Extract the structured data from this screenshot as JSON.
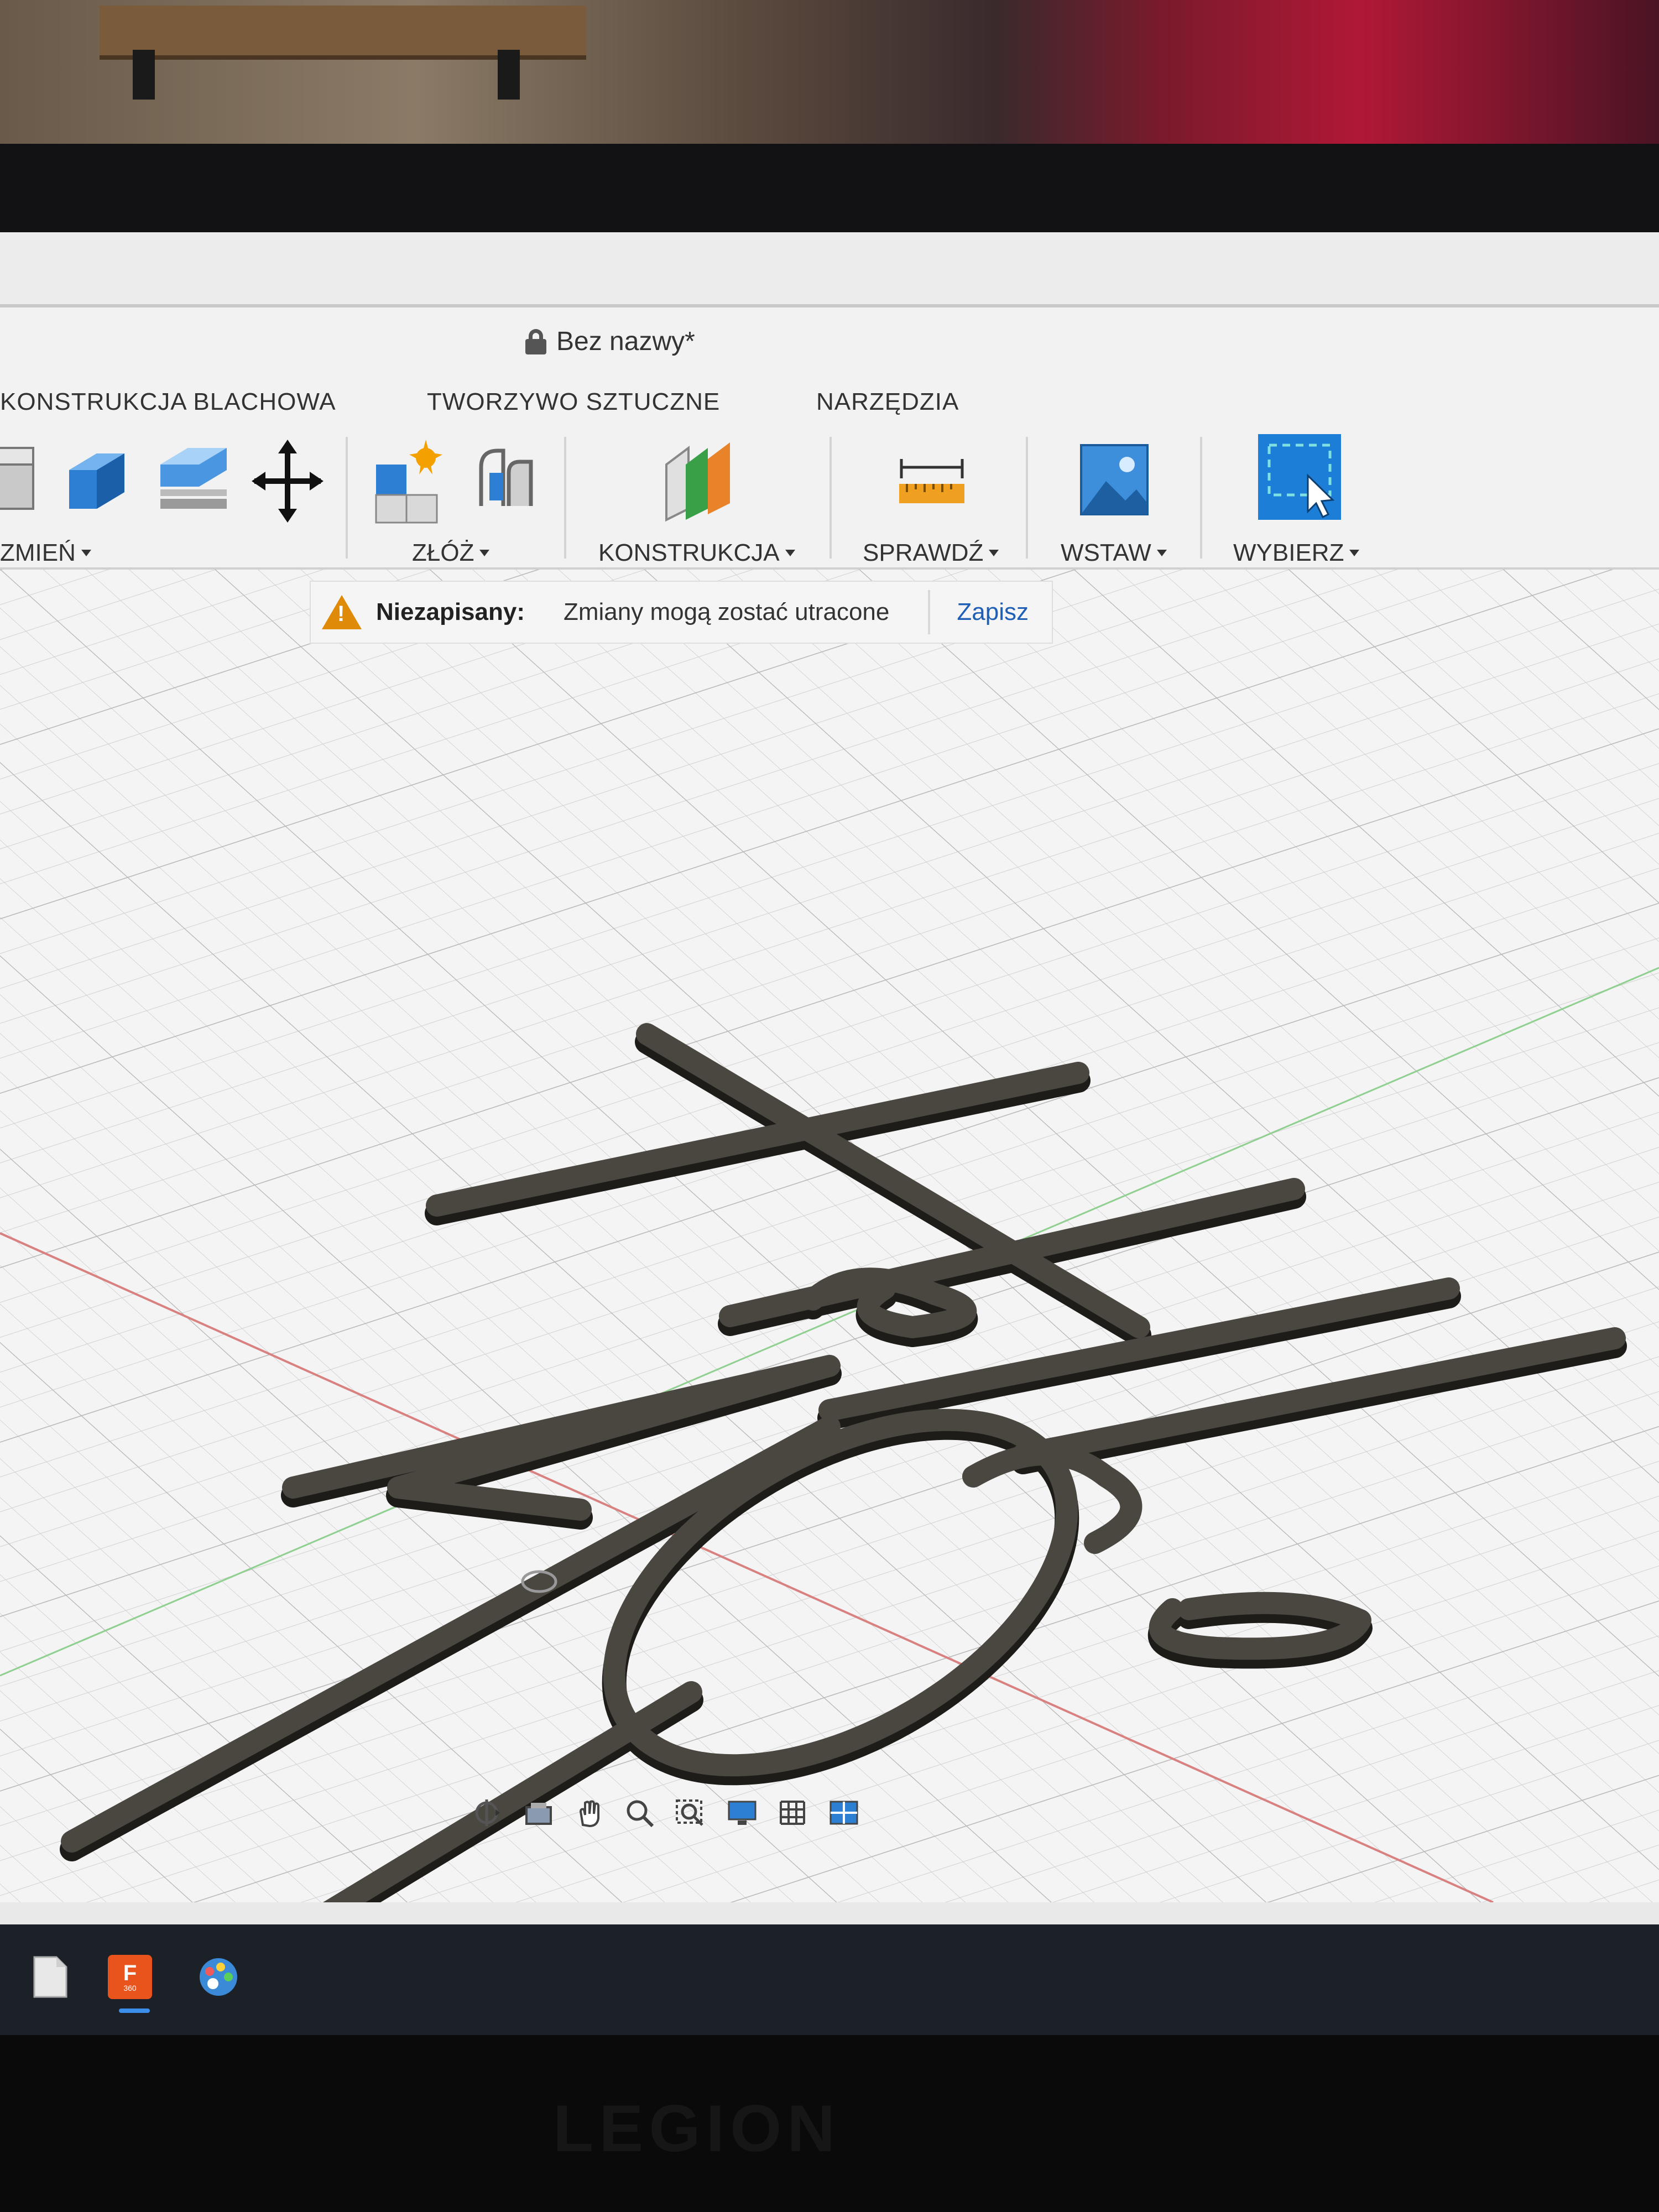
{
  "document": {
    "title": "Bez nazwy*"
  },
  "tabs": [
    {
      "label": "KONSTRUKCJA BLACHOWA"
    },
    {
      "label": "TWORZYWO SZTUCZNE"
    },
    {
      "label": "NARZĘDZIA"
    }
  ],
  "tool_groups": [
    {
      "label": "ZMIEŃ"
    },
    {
      "label": "ZŁÓŻ"
    },
    {
      "label": "KONSTRUKCJA"
    },
    {
      "label": "SPRAWDŹ"
    },
    {
      "label": "WSTAW"
    },
    {
      "label": "WYBIERZ"
    }
  ],
  "banner": {
    "title": "Niezapisany:",
    "message": "Zmiany mogą zostać utracone",
    "action": "Zapisz"
  },
  "navbar_icons": [
    "orbit-icon",
    "look-at-icon",
    "pan-icon",
    "zoom-icon",
    "fit-icon",
    "display-settings-icon",
    "grid-icon",
    "viewports-icon"
  ],
  "taskbar_icons": [
    "file-icon",
    "fusion-360-icon",
    "paint-icon"
  ],
  "taskbar_fusion_label": "360",
  "colors": {
    "accent": "#1f5fb5",
    "warning": "#e08a0a",
    "model": "#3d3a35",
    "select_blue": "#1c7ed6"
  },
  "hardware_label": "LEGION"
}
